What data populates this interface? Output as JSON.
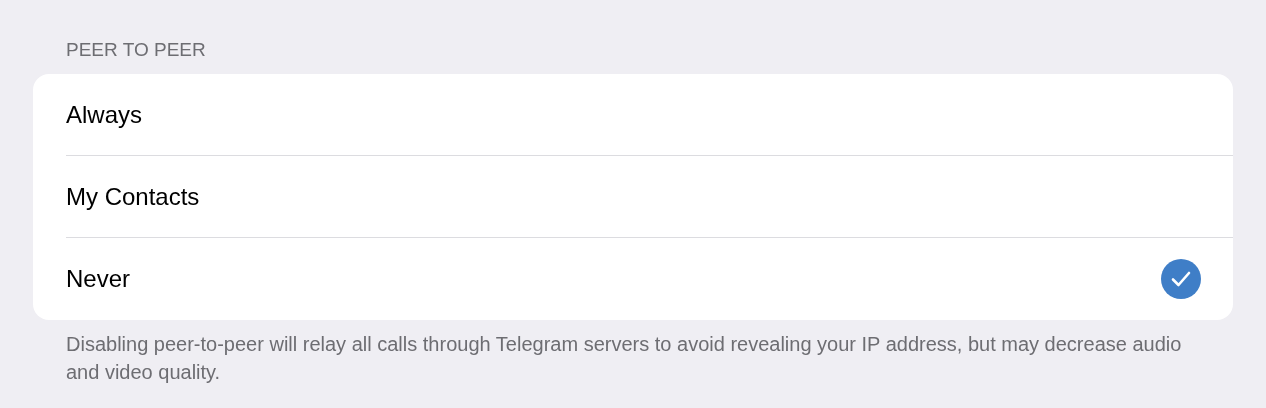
{
  "section": {
    "header": "PEER TO PEER",
    "options": [
      {
        "label": "Always",
        "selected": false
      },
      {
        "label": "My Contacts",
        "selected": false
      },
      {
        "label": "Never",
        "selected": true
      }
    ],
    "footer": "Disabling peer-to-peer will relay all calls through Telegram servers to avoid revealing your IP address, but may decrease audio and video quality."
  }
}
